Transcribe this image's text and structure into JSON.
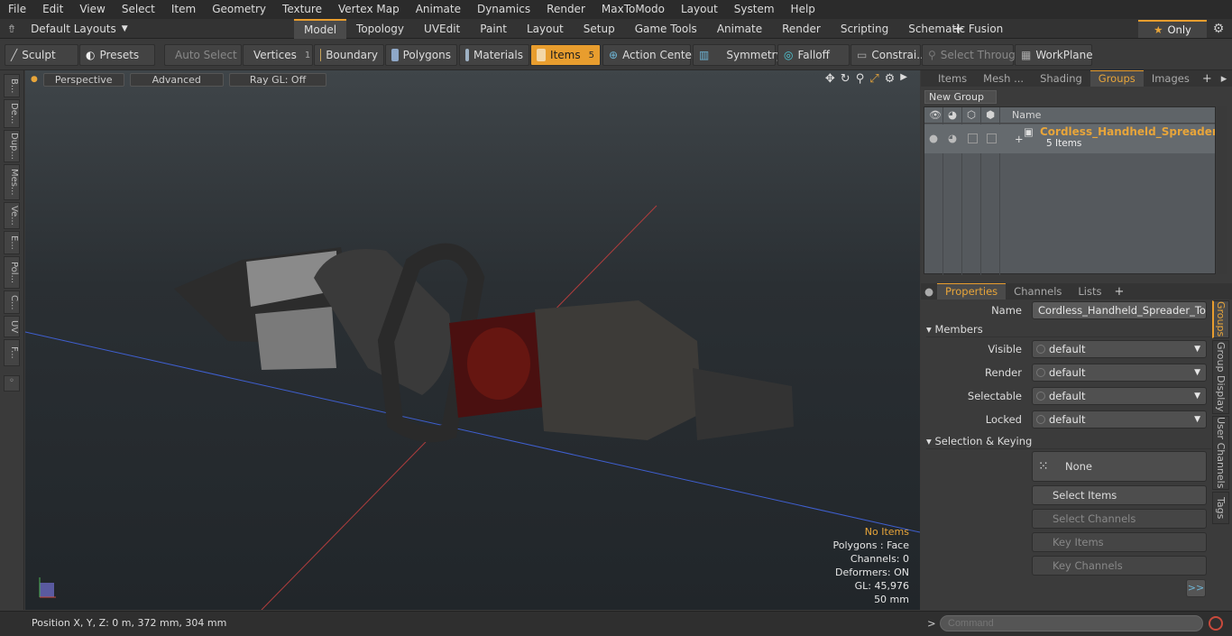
{
  "menu": [
    "File",
    "Edit",
    "View",
    "Select",
    "Item",
    "Geometry",
    "Texture",
    "Vertex Map",
    "Animate",
    "Dynamics",
    "Render",
    "MaxToModo",
    "Layout",
    "System",
    "Help"
  ],
  "layouts": {
    "label": "Default Layouts"
  },
  "tabs": [
    "Model",
    "Topology",
    "UVEdit",
    "Paint",
    "Layout",
    "Setup",
    "Game Tools",
    "Animate",
    "Render",
    "Scripting",
    "Schematic Fusion"
  ],
  "only": "Only",
  "toolbar": {
    "sculpt": "Sculpt",
    "presets": "Presets",
    "auto_select": "Auto Select",
    "vertices": "Vertices",
    "vertices_count": "1",
    "boundary": "Boundary",
    "polygons": "Polygons",
    "materials": "Materials",
    "items": "Items",
    "items_count": "5",
    "action_center": "Action Center",
    "symmetry": "Symmetry",
    "falloff": "Falloff",
    "constraints": "Constrai...",
    "select_through": "Select Through",
    "workplane": "WorkPlane"
  },
  "lefttools": [
    "B...",
    "De...",
    "Dup...",
    "Mes...",
    "Ve...",
    "E...",
    "Pol...",
    "C...",
    "UV",
    "F..."
  ],
  "viewport": {
    "perspective": "Perspective",
    "advanced": "Advanced",
    "raygl": "Ray GL: Off",
    "stats": {
      "items": "No Items",
      "polygons": "Polygons : Face",
      "channels": "Channels: 0",
      "deformers": "Deformers: ON",
      "gl": "GL: 45,976",
      "scale": "50 mm"
    }
  },
  "status": {
    "position": "Position X, Y, Z:   0 m, 372 mm, 304 mm",
    "command_placeholder": "Command"
  },
  "groups_panel": {
    "tabs": [
      "Items",
      "Mesh ...",
      "Shading",
      "Groups",
      "Images"
    ],
    "new_group": "New Group",
    "col_name": "Name",
    "group_name": "Cordless_Handheld_Spreader_T...",
    "group_count": "5 Items"
  },
  "props_panel": {
    "tabs": [
      "Properties",
      "Channels",
      "Lists"
    ],
    "name_label": "Name",
    "name_value": "Cordless_Handheld_Spreader_Tool_Di",
    "members": "Members",
    "visible_label": "Visible",
    "visible": "default",
    "render_label": "Render",
    "render": "default",
    "selectable_label": "Selectable",
    "selectable": "default",
    "locked_label": "Locked",
    "locked": "default",
    "selection_keying": "Selection & Keying",
    "none": "None",
    "select_items": "Select Items",
    "select_channels": "Select Channels",
    "key_items": "Key Items",
    "key_channels": "Key Channels",
    "more": ">>",
    "vtabs": [
      "Groups",
      "Group Display",
      "User Channels",
      "Tags"
    ]
  },
  "colors": {
    "accent": "#e89d2e"
  }
}
